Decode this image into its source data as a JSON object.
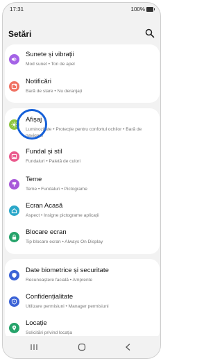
{
  "status": {
    "time": "17:31",
    "battery": "100%"
  },
  "header": {
    "title": "Setări"
  },
  "items": [
    {
      "label": "Sunete și vibrații",
      "sub": "Mod sunet  •  Ton de apel",
      "icon": "volume-icon",
      "color": "#a463e6"
    },
    {
      "label": "Notificări",
      "sub": "Bară de stare  •  Nu deranjați",
      "icon": "notification-icon",
      "color": "#f07263"
    },
    {
      "label": "Afișaj",
      "sub": "Luminozitate  •  Protecție pentru confortul ochilor  •  Bară de navigare",
      "icon": "display-icon",
      "color": "#8dc63f"
    },
    {
      "label": "Fundal și stil",
      "sub": "Fundaluri  •  Paletă de culori",
      "icon": "wallpaper-icon",
      "color": "#ea5a8d"
    },
    {
      "label": "Teme",
      "sub": "Teme  •  Fundaluri  •  Pictograme",
      "icon": "themes-icon",
      "color": "#a85ad9"
    },
    {
      "label": "Ecran Acasă",
      "sub": "Aspect  •  Insigne pictograme aplicații",
      "icon": "home-icon",
      "color": "#2aa7c9"
    },
    {
      "label": "Blocare ecran",
      "sub": "Tip blocare ecran  •  Always On Display",
      "icon": "lock-icon",
      "color": "#25a36a"
    },
    {
      "label": "Date biometrice și securitate",
      "sub": "Recunoaștere facială  •  Amprente",
      "icon": "shield-icon",
      "color": "#3b63d6"
    },
    {
      "label": "Confidențialitate",
      "sub": "Utilizare permisiuni  •  Manager permisiuni",
      "icon": "privacy-icon",
      "color": "#3b63d6"
    },
    {
      "label": "Locație",
      "sub": "Solicitări privind locația",
      "icon": "location-icon",
      "color": "#25a36a"
    }
  ]
}
